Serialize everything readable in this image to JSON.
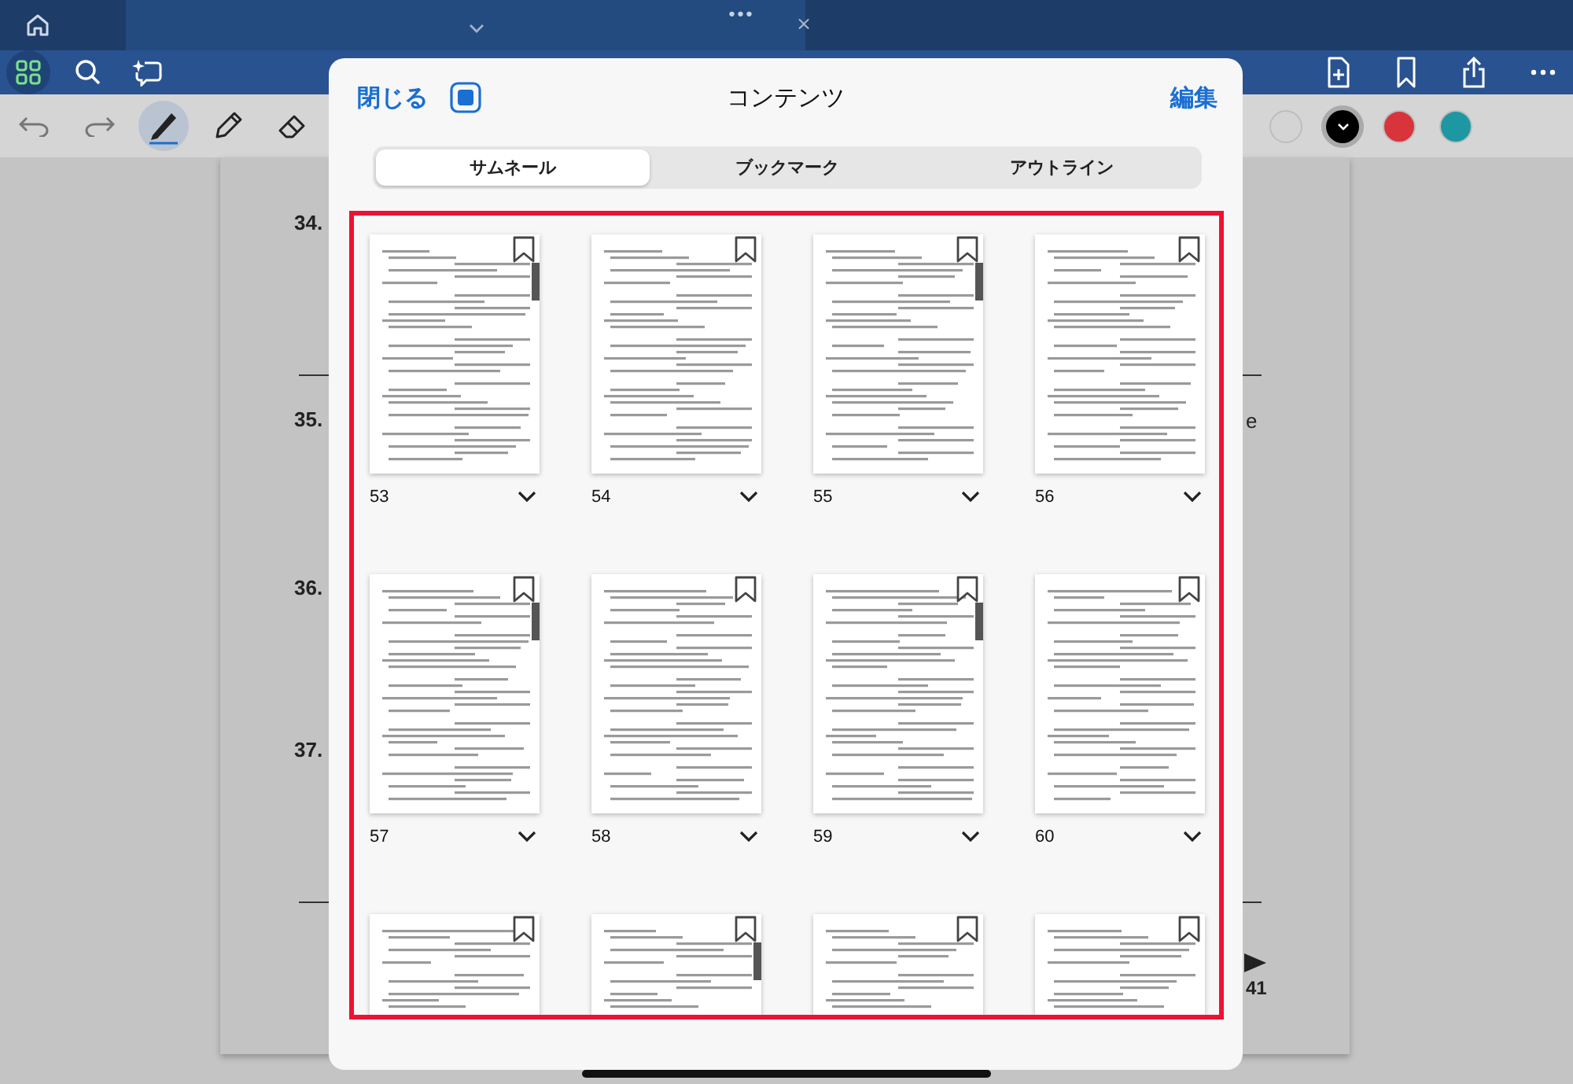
{
  "top_bar": {
    "tab_menu": "•••",
    "tab_close": "×"
  },
  "toolbar": {
    "left": [
      {
        "selected": true
      },
      {
        "selected": false
      },
      {
        "selected": false
      }
    ]
  },
  "pen_toolbar": {
    "tools": [
      {
        "selected": false
      },
      {
        "selected": false
      },
      {
        "selected": true
      },
      {
        "selected": false
      },
      {
        "selected": false
      }
    ],
    "colors": [
      {
        "color": "#d4d4d4",
        "selected": false
      },
      {
        "color": "#000000",
        "selected": true
      },
      {
        "color": "#d8343c",
        "selected": false
      },
      {
        "color": "#1d98a3",
        "selected": false
      }
    ]
  },
  "document": {
    "question_numbers": [
      "34.",
      "35.",
      "36.",
      "37."
    ],
    "fragment": "e",
    "page_number": "41"
  },
  "contents_panel": {
    "close": "閉じる",
    "title": "コンテンツ",
    "edit": "編集",
    "tabs": [
      {
        "label": "サムネール",
        "selected": true
      },
      {
        "label": "ブックマーク",
        "selected": false
      },
      {
        "label": "アウトライン",
        "selected": false
      }
    ],
    "thumbnails": [
      {
        "page": "53",
        "side_tab": true
      },
      {
        "page": "54",
        "side_tab": false
      },
      {
        "page": "55",
        "side_tab": true
      },
      {
        "page": "56",
        "side_tab": false
      },
      {
        "page": "57",
        "side_tab": true
      },
      {
        "page": "58",
        "side_tab": false
      },
      {
        "page": "59",
        "side_tab": true
      },
      {
        "page": "60",
        "side_tab": false
      },
      {
        "side_tab": false
      },
      {
        "side_tab": true
      },
      {
        "side_tab": false
      },
      {
        "side_tab": false
      }
    ]
  }
}
